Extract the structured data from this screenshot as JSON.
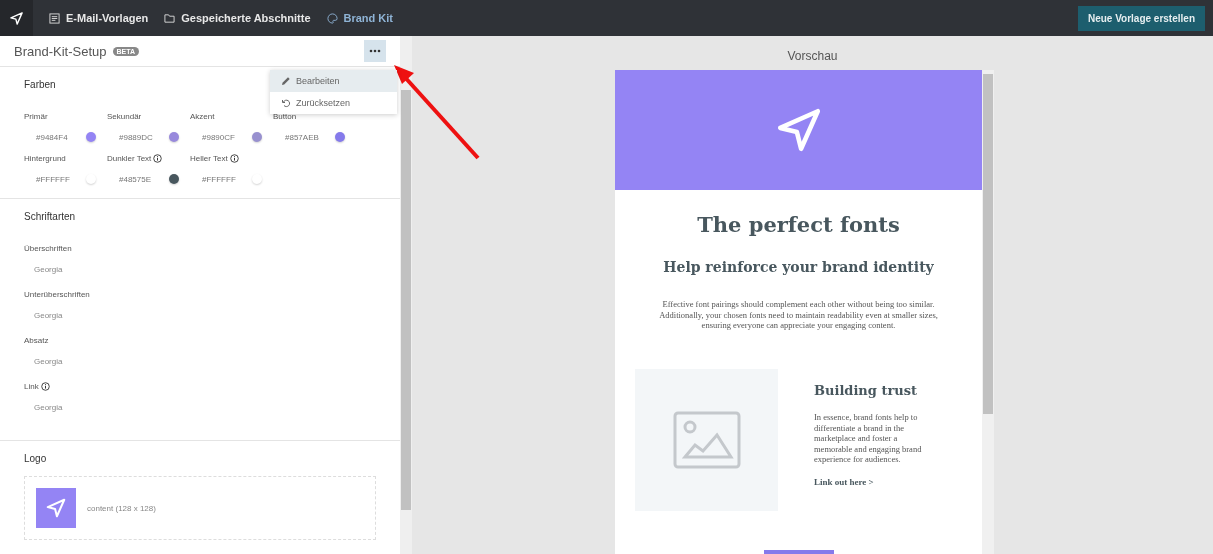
{
  "topbar": {
    "nav": [
      {
        "label": "E-Mail-Vorlagen",
        "selected": false
      },
      {
        "label": "Gespeicherte Abschnitte",
        "selected": false
      },
      {
        "label": "Brand Kit",
        "selected": true
      }
    ],
    "create_button": "Neue Vorlage erstellen"
  },
  "panel": {
    "title": "Brand-Kit-Setup",
    "badge": "BETA",
    "menu": {
      "items": [
        {
          "label": "Bearbeiten",
          "selected": true
        },
        {
          "label": "Zurücksetzen",
          "selected": false
        }
      ]
    },
    "colors": {
      "heading": "Farben",
      "swatches": [
        {
          "label": "Primär",
          "value": "#9484F4",
          "color": "#9484f4",
          "info": false
        },
        {
          "label": "Sekundär",
          "value": "#9889DC",
          "color": "#9889dc",
          "info": false
        },
        {
          "label": "Akzent",
          "value": "#9890CF",
          "color": "#9890cf",
          "info": false
        },
        {
          "label": "Button",
          "value": "#857AEB",
          "color": "#857aeb",
          "info": false
        },
        {
          "label": "Hintergrund",
          "value": "#FFFFFF",
          "color": "#ffffff",
          "info": false
        },
        {
          "label": "Dunkler Text",
          "value": "#48575E",
          "color": "#48575e",
          "info": true
        },
        {
          "label": "Heller Text",
          "value": "#FFFFFF",
          "color": "#ffffff",
          "info": true
        }
      ]
    },
    "fonts": {
      "heading": "Schriftarten",
      "items": [
        {
          "label": "Überschriften",
          "value": "Georgia",
          "info": false
        },
        {
          "label": "Unterüberschriften",
          "value": "Georgia",
          "info": false
        },
        {
          "label": "Absatz",
          "value": "Georgia",
          "info": false
        },
        {
          "label": "Link",
          "value": "Georgia",
          "info": true
        }
      ]
    },
    "logo": {
      "heading": "Logo",
      "caption": "content (128 x 128)"
    }
  },
  "preview": {
    "title": "Vorschau",
    "heading": "The perfect fonts",
    "subheading": "Help reinforce your brand identity",
    "paragraph": "Effective font pairings should complement each other without being too similar. Additionally, your chosen fonts need to maintain readability even at smaller sizes, ensuring everyone can appreciate your engaging content.",
    "card_title": "Building trust",
    "card_text": "In essence, brand fonts help to differentiate a brand in the marketplace and foster a memorable and engaging brand experience for audiences.",
    "card_link": "Link out here >"
  }
}
